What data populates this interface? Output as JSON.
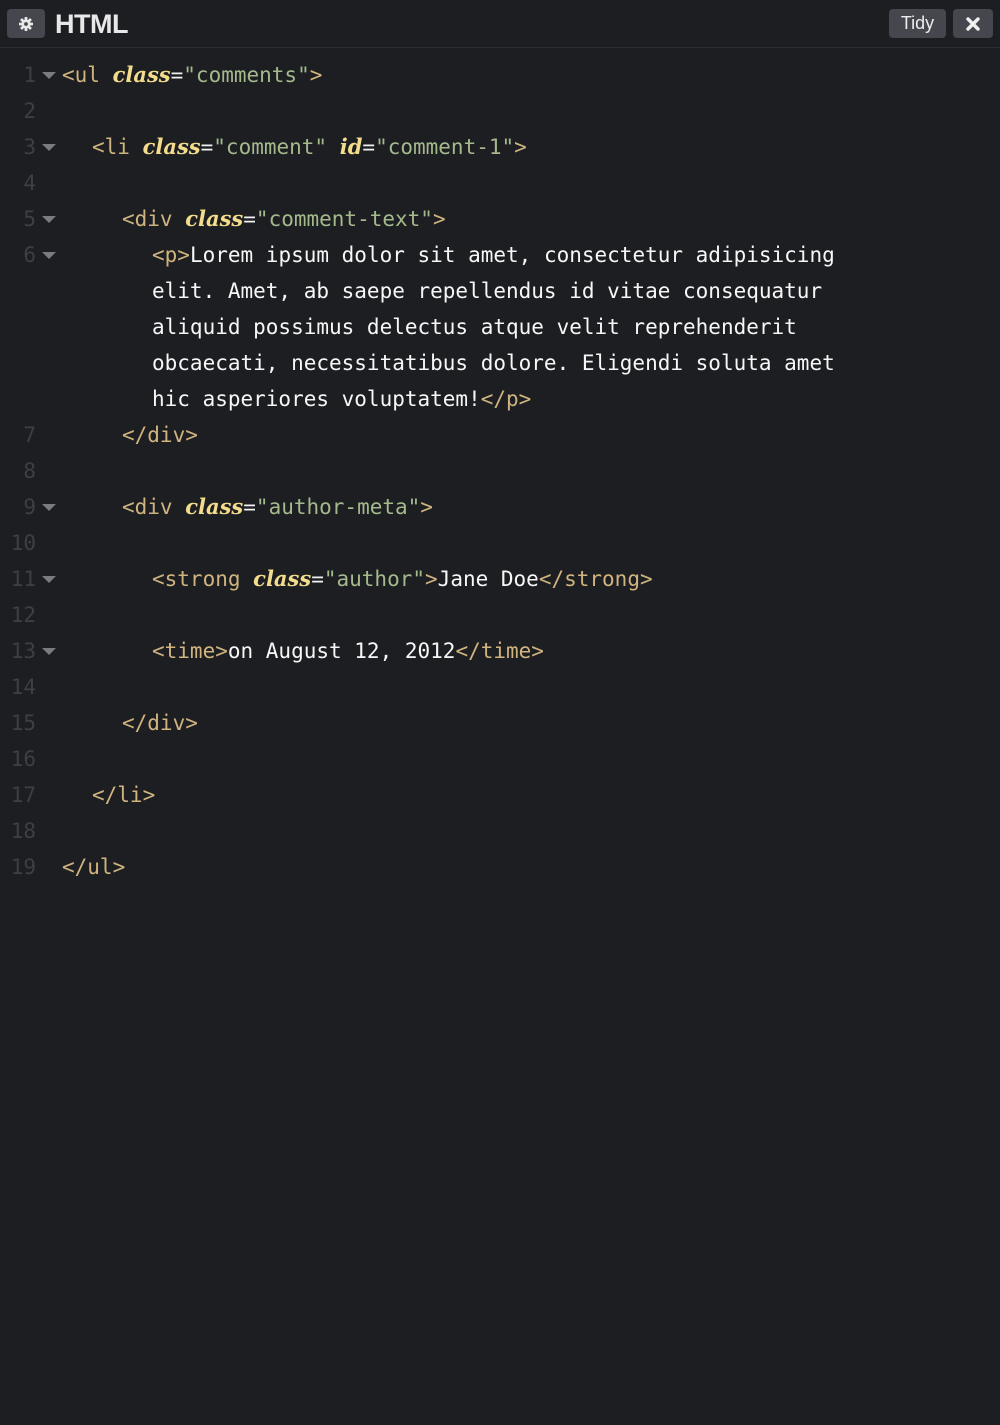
{
  "header": {
    "settings_icon": "gear-icon",
    "title": "HTML",
    "tidy_label": "Tidy",
    "close_icon": "close-icon"
  },
  "line_numbers": [
    "1",
    "2",
    "3",
    "4",
    "5",
    "6",
    "7",
    "8",
    "9",
    "10",
    "11",
    "12",
    "13",
    "14",
    "15",
    "16",
    "17",
    "18",
    "19"
  ],
  "fold_lines": [
    "1",
    "3",
    "5",
    "6",
    "9",
    "11",
    "13"
  ],
  "code": {
    "l1_open": "<ul",
    "l1_attr": "class",
    "l1_eq": "=",
    "l1_val": "\"comments\"",
    "l1_close": ">",
    "l3_open": "<li",
    "l3_attr1": "class",
    "l3_val1": "\"comment\"",
    "l3_attr2": "id",
    "l3_val2": "\"comment-1\"",
    "l3_close": ">",
    "l5_open": "<div",
    "l5_attr": "class",
    "l5_val": "\"comment-text\"",
    "l5_close": ">",
    "l6_p_open": "<p>",
    "l6_text_1": "Lorem ipsum dolor sit amet, consectetur adipisicing",
    "l6_text_2": "elit. Amet, ab saepe repellendus id vitae consequatur",
    "l6_text_3": "aliquid possimus delectus atque velit reprehenderit",
    "l6_text_4": "obcaecati, necessitatibus dolore. Eligendi soluta amet",
    "l6_text_5": "hic asperiores voluptatem!",
    "l6_p_close": "</p>",
    "l7": "</div>",
    "l9_open": "<div",
    "l9_attr": "class",
    "l9_val": "\"author-meta\"",
    "l9_close": ">",
    "l11_open": "<strong",
    "l11_attr": "class",
    "l11_val": "\"author\"",
    "l11_close": ">",
    "l11_text": "Jane Doe",
    "l11_end": "</strong>",
    "l13_open": "<time>",
    "l13_text": "on August 12, 2012",
    "l13_end": "</time>",
    "l15": "</div>",
    "l17": "</li>",
    "l19": "</ul>"
  }
}
